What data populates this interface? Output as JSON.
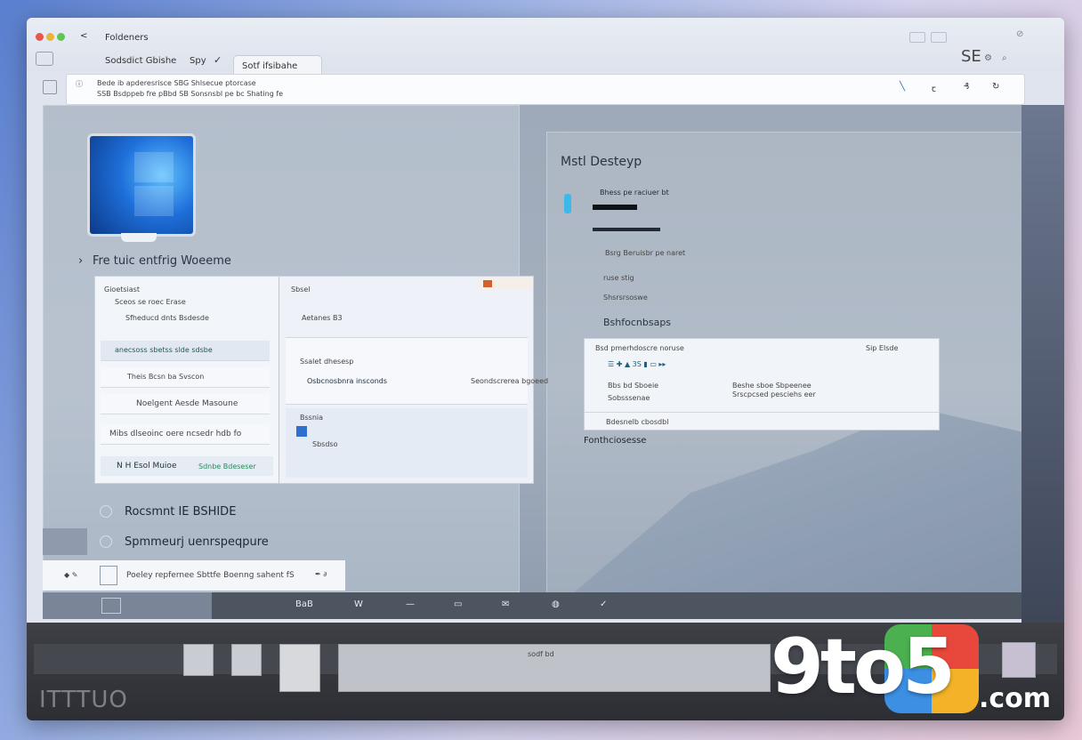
{
  "window": {
    "title": "Foldeners",
    "back_glyph": "<",
    "status_right": "SE"
  },
  "tabs": {
    "inactive_label": "Sodsdict Gbishe",
    "inactive_extra": "Spy",
    "active_label": "Sotf ifsibahe"
  },
  "address": {
    "line1": "Bede ib apderesrisce  SBG  Shlsecue  ptorcase",
    "line2": "SSB  Bsdppeb fre pBbd  SB  Sonsnsbl pe bc  Shating fe"
  },
  "desktop": {
    "computer_label": "Fre tuic entfrig Woeeme",
    "list_items": [
      {
        "label": "Rocsmnt IE BSHIDE"
      },
      {
        "label": "Spmmeurj uenrspeqpure"
      }
    ],
    "bottom_bar_text": "Poeley repfernee  Sbttfe Boenng sahent fS",
    "right_title": "Mstl Desteyp",
    "right_rows": [
      "Bhess pe raciuer bt",
      "Bsrg Beruisbr pe naret",
      "ruse stig",
      "Shsrsrsoswe",
      "Bshfocnbsaps"
    ],
    "right_footer": "Fonthciosesse"
  },
  "explorer_card": {
    "left_items": [
      "Gioetsiast",
      "Sceos se roec Erase",
      "Sfheducd dnts Bsdesde",
      "anecsoss sbetss slde sdsbe",
      "Theis Bcsn ba Svscon",
      "Noelgent Aesde Masoune",
      "Mibs dlseoinc oere ncsedr hdb fo"
    ],
    "left_footer": "N H Esol Muioe",
    "left_footer_sub": "Sdnbe Bdeseser",
    "right_header": "Sbsel",
    "right_rows": [
      "Aetanes  B3",
      "Ssalet dhesesp",
      "Osbcnosbnra insconds",
      "Seondscrerea bgoeed",
      "Bssnia",
      "Sbsdso"
    ]
  },
  "settings_card": {
    "header": "Bsd pmerhdoscre noruse",
    "header_right": "Sip Elsde",
    "rows": [
      "Bbs bd Sboeie",
      "Sobsssenae",
      "Beshe sboe Sbpeenee",
      "Srscpcsed pesciehs eer",
      "Bdesnelb cbosdbl"
    ]
  },
  "taskbar": {
    "icons": [
      "search-icon",
      "edit-icon",
      "menu-icon",
      "window-icon",
      "mail-icon",
      "globe-icon",
      "pen-icon"
    ],
    "labels": [
      "BaB",
      "W",
      "—",
      "▭",
      "✉",
      "◍",
      "✓"
    ]
  },
  "dock": {
    "left_text": "ITTTUO",
    "search_hint": "sodf bd"
  },
  "branding": {
    "logo_main": "9to5",
    "logo_domain": ".com"
  },
  "colors": {
    "accent": "#1e6fd9",
    "titlebar": "#e3e7ef",
    "taskbar": "#4d5561",
    "dock": "#34363b"
  }
}
